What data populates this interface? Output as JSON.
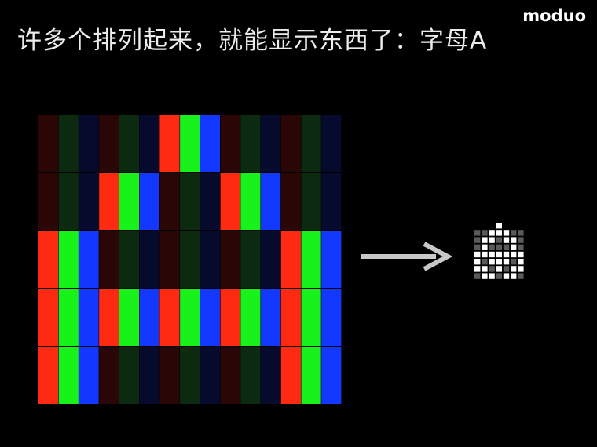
{
  "caption": "许多个排列起来，就能显示东西了：字母A",
  "watermark": "moduo",
  "pixel_grid": {
    "rows": 5,
    "cols": 5,
    "lit": [
      [
        0,
        0,
        1,
        0,
        0
      ],
      [
        0,
        1,
        0,
        1,
        0
      ],
      [
        1,
        0,
        0,
        0,
        1
      ],
      [
        1,
        1,
        1,
        1,
        1
      ],
      [
        1,
        0,
        0,
        0,
        1
      ]
    ]
  },
  "result_icon": {
    "rows": 8,
    "cols": 8,
    "lit": [
      [
        0,
        0,
        0,
        1,
        0,
        0,
        0,
        0
      ],
      [
        0,
        0,
        1,
        1,
        1,
        0,
        0,
        0
      ],
      [
        0,
        1,
        1,
        0,
        1,
        1,
        0,
        0
      ],
      [
        0,
        1,
        0,
        0,
        0,
        1,
        0,
        0
      ],
      [
        1,
        1,
        1,
        1,
        1,
        1,
        1,
        0
      ],
      [
        1,
        0,
        1,
        1,
        1,
        0,
        1,
        0
      ],
      [
        1,
        1,
        0,
        1,
        0,
        1,
        1,
        0
      ],
      [
        0,
        1,
        1,
        0,
        1,
        1,
        0,
        0
      ]
    ]
  },
  "colors": {
    "red_on": "#ff2a12",
    "green_on": "#19f21a",
    "blue_on": "#1238ff",
    "red_off": "#2a0606",
    "green_off": "#0b2a10",
    "blue_off": "#060a2c",
    "arrow": "#c8c8c8",
    "icon_on": "#ffffff",
    "icon_off": "#5a5a5a"
  }
}
